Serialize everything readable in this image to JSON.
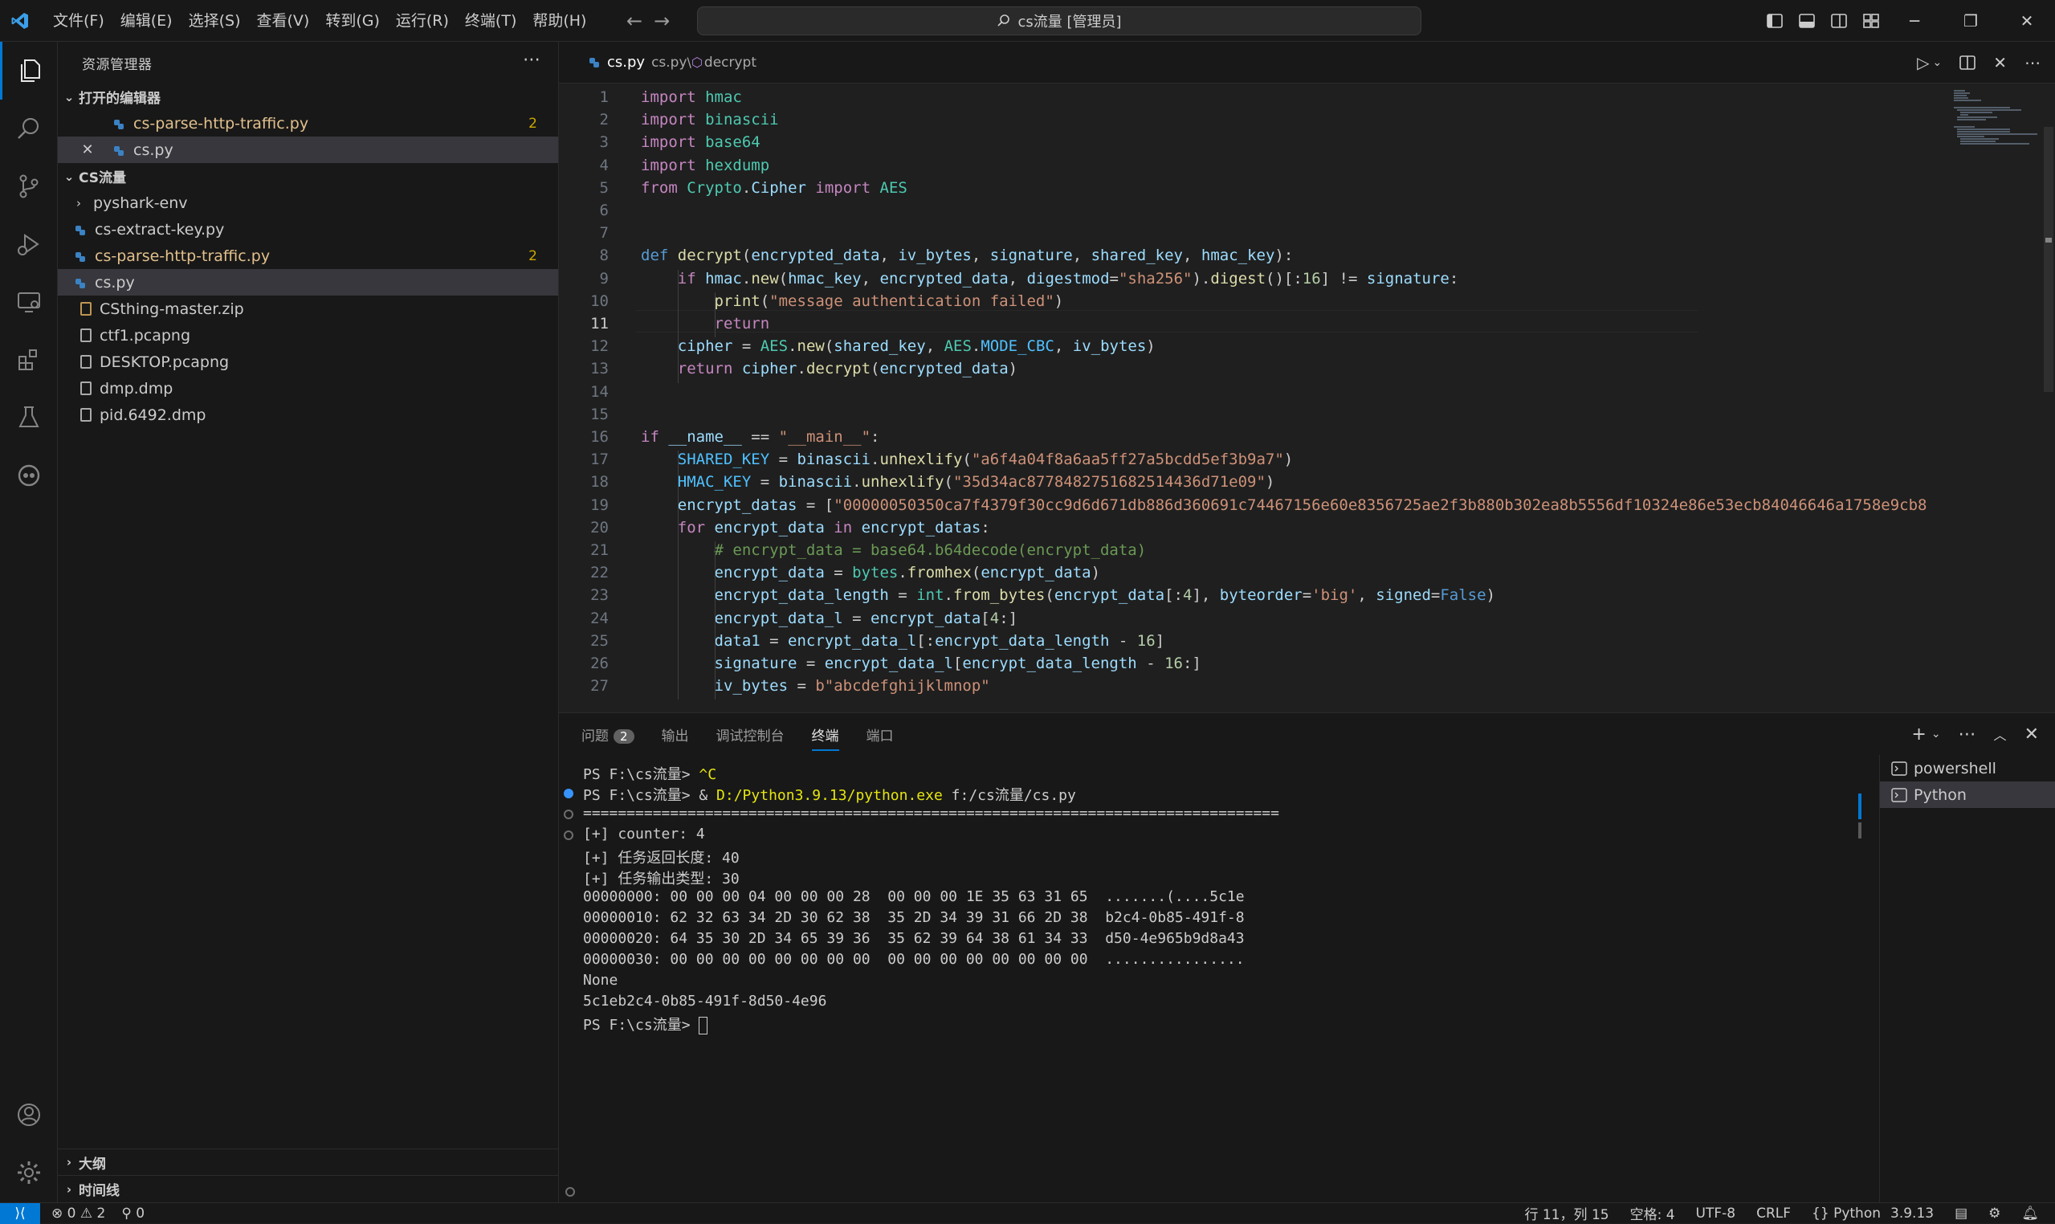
{
  "titlebar": {
    "menu": [
      "文件(F)",
      "编辑(E)",
      "选择(S)",
      "查看(V)",
      "转到(G)",
      "运行(R)",
      "终端(T)",
      "帮助(H)"
    ],
    "command_center": "cs流量 [管理员]"
  },
  "sidebar": {
    "title": "资源管理器",
    "open_editors_label": "打开的编辑器",
    "open_editors": [
      {
        "name": "cs-parse-http-traffic.py",
        "badge": "2"
      },
      {
        "name": "cs.py"
      }
    ],
    "folder_label": "CS流量",
    "files": [
      {
        "name": "pyshark-env"
      },
      {
        "name": "cs-extract-key.py"
      },
      {
        "name": "cs-parse-http-traffic.py",
        "badge": "2"
      },
      {
        "name": "cs.py"
      },
      {
        "name": "CSthing-master.zip"
      },
      {
        "name": "ctf1.pcapng"
      },
      {
        "name": "DESKTOP.pcapng"
      },
      {
        "name": "dmp.dmp"
      },
      {
        "name": "pid.6492.dmp"
      }
    ],
    "outline_label": "大纲",
    "timeline_label": "时间线"
  },
  "editor": {
    "tab_file": "cs.py",
    "breadcrumb_file": "cs.py",
    "breadcrumb_symbol": "decrypt",
    "current_line": 11,
    "lines": [
      "import hmac",
      "import binascii",
      "import base64",
      "import hexdump",
      "from Crypto.Cipher import AES",
      "",
      "",
      "def decrypt(encrypted_data, iv_bytes, signature, shared_key, hmac_key):",
      "    if hmac.new(hmac_key, encrypted_data, digestmod=\"sha256\").digest()[:16] != signature:",
      "        print(\"message authentication failed\")",
      "        return",
      "    cipher = AES.new(shared_key, AES.MODE_CBC, iv_bytes)",
      "    return cipher.decrypt(encrypted_data)",
      "",
      "",
      "if __name__ == \"__main__\":",
      "    SHARED_KEY = binascii.unhexlify(\"a6f4a04f8a6aa5ff27a5bcdd5ef3b9a7\")",
      "    HMAC_KEY = binascii.unhexlify(\"35d34ac8778482751682514436d71e09\")",
      "    encrypt_datas = [\"00000050350ca7f4379f30cc9d6d671db886d360691c74467156e60e8356725ae2f3b880b302ea8b5556df10324e86e53ecb84046646a1758e9cb8",
      "    for encrypt_data in encrypt_datas:",
      "        # encrypt_data = base64.b64decode(encrypt_data)",
      "        encrypt_data = bytes.fromhex(encrypt_data)",
      "        encrypt_data_length = int.from_bytes(encrypt_data[:4], byteorder='big', signed=False)",
      "        encrypt_data_l = encrypt_data[4:]",
      "        data1 = encrypt_data_l[:encrypt_data_length - 16]",
      "        signature = encrypt_data_l[encrypt_data_length - 16:]",
      "        iv_bytes = b\"abcdefghijklmnop\""
    ]
  },
  "panel": {
    "tabs": [
      "问题",
      "输出",
      "调试控制台",
      "终端",
      "端口"
    ],
    "problems_count": "2",
    "active_tab": "终端",
    "terminal_lines": [
      "PS F:\\cs流量> ^C",
      "PS F:\\cs流量> & D:/Python3.9.13/python.exe f:/cs流量/cs.py",
      "================================================================================",
      "[+] counter: 4",
      "[+] 任务返回长度: 40",
      "[+] 任务输出类型: 30",
      "00000000: 00 00 00 04 00 00 00 28  00 00 00 1E 35 63 31 65  .......(....5c1e",
      "00000010: 62 32 63 34 2D 30 62 38  35 2D 34 39 31 66 2D 38  b2c4-0b85-491f-8",
      "00000020: 64 35 30 2D 34 65 39 36  35 62 39 64 38 61 34 33  d50-4e965b9d8a43",
      "00000030: 00 00 00 00 00 00 00 00  00 00 00 00 00 00 00 00  ................",
      "None",
      "5c1eb2c4-0b85-491f-8d50-4e96",
      "PS F:\\cs流量> "
    ],
    "terminals": [
      "powershell",
      "Python"
    ]
  },
  "statusbar": {
    "errors": "0",
    "warnings": "2",
    "ports": "0",
    "position": "行 11，列 15",
    "spaces": "空格: 4",
    "encoding": "UTF-8",
    "eol": "CRLF",
    "language": "{} Python",
    "python_version": "3.9.13"
  },
  "colors": {
    "accent": "#0078d4",
    "background": "#1f1f1f",
    "sidebar": "#181818",
    "modified": "#e2c08d"
  }
}
